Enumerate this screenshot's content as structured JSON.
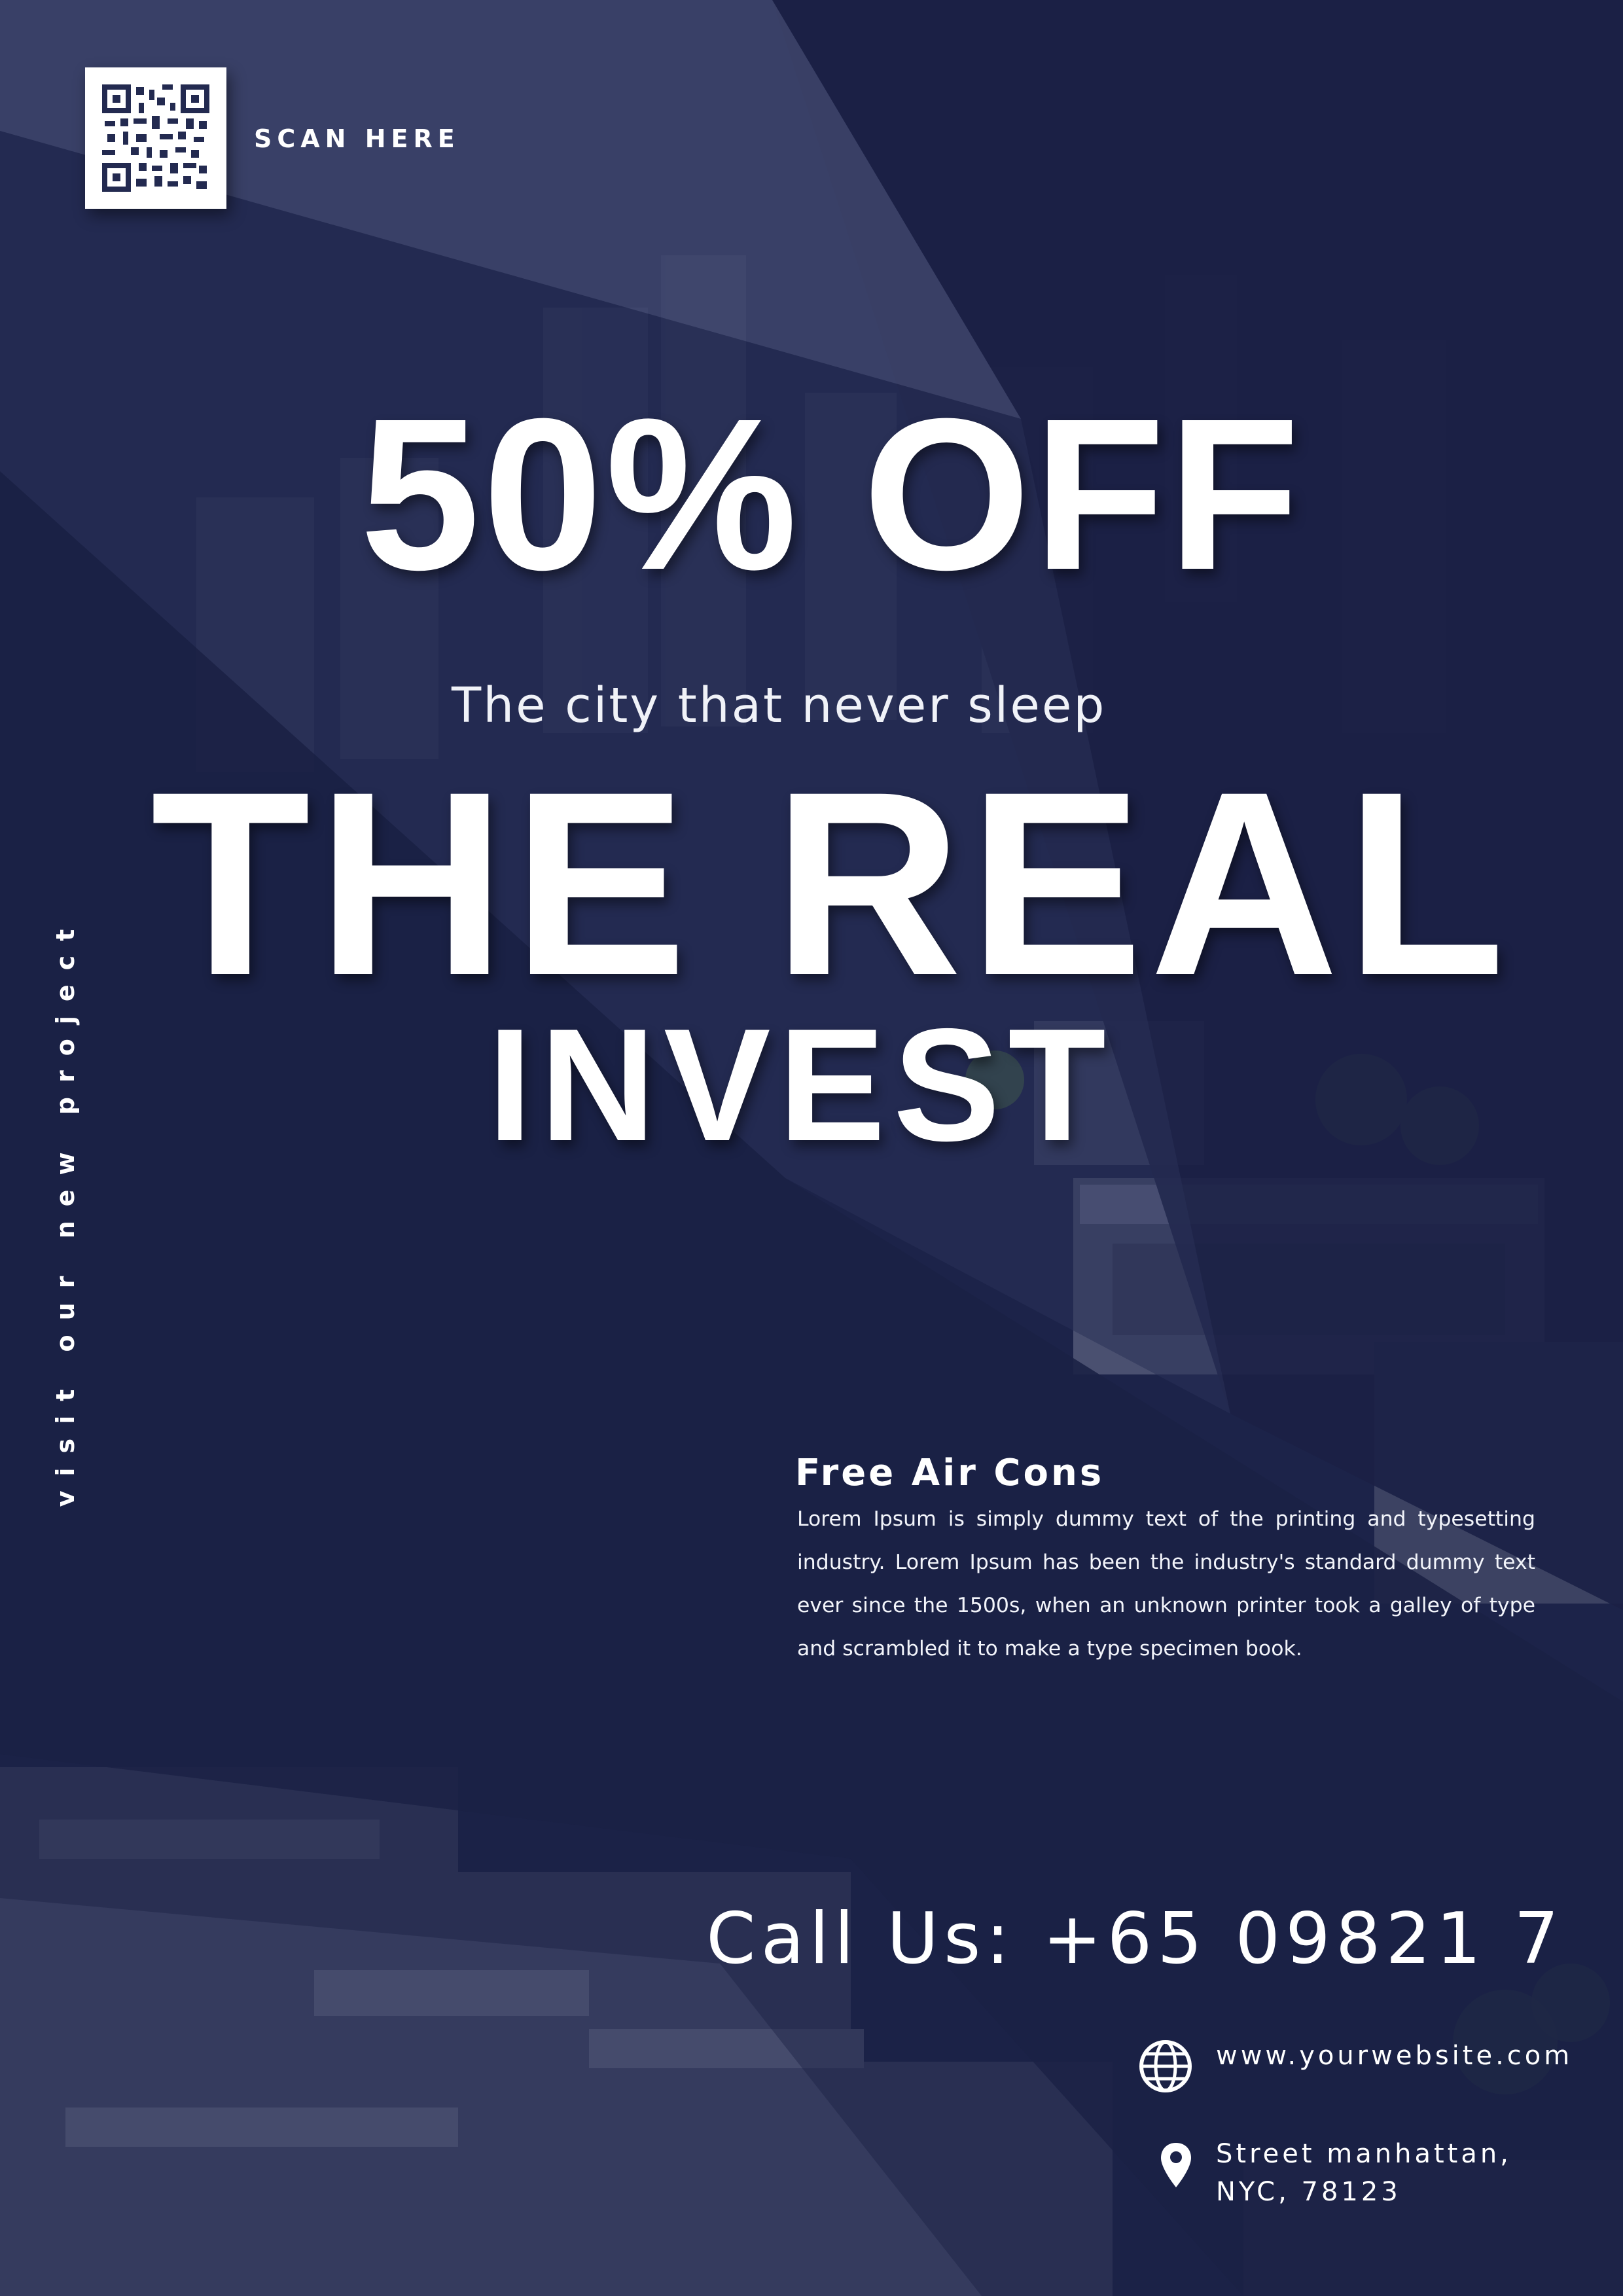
{
  "qr": {
    "label": "SCAN HERE"
  },
  "headline": {
    "discount": "50% OFF",
    "tagline": "The city that never sleep",
    "title_line1": "THE REAL",
    "title_line2": "INVEST"
  },
  "side_text": "visit our new project",
  "feature": {
    "title": "Free Air Cons",
    "body": "Lorem Ipsum is simply dummy text of the printing and typesetting industry. Lorem Ipsum has been the industry's standard dummy text ever since the 1500s, when an unknown printer took a galley of type and scrambled it to make a type specimen book."
  },
  "contact": {
    "phone": "Call Us: +65 09821 7",
    "website": "www.yourwebsite.com",
    "address_line1": "Street manhattan,",
    "address_line2": "NYC, 78123"
  },
  "colors": {
    "background": "#1c2248",
    "text": "#ffffff"
  },
  "icons": {
    "website": "globe-icon",
    "address": "map-pin-icon"
  }
}
